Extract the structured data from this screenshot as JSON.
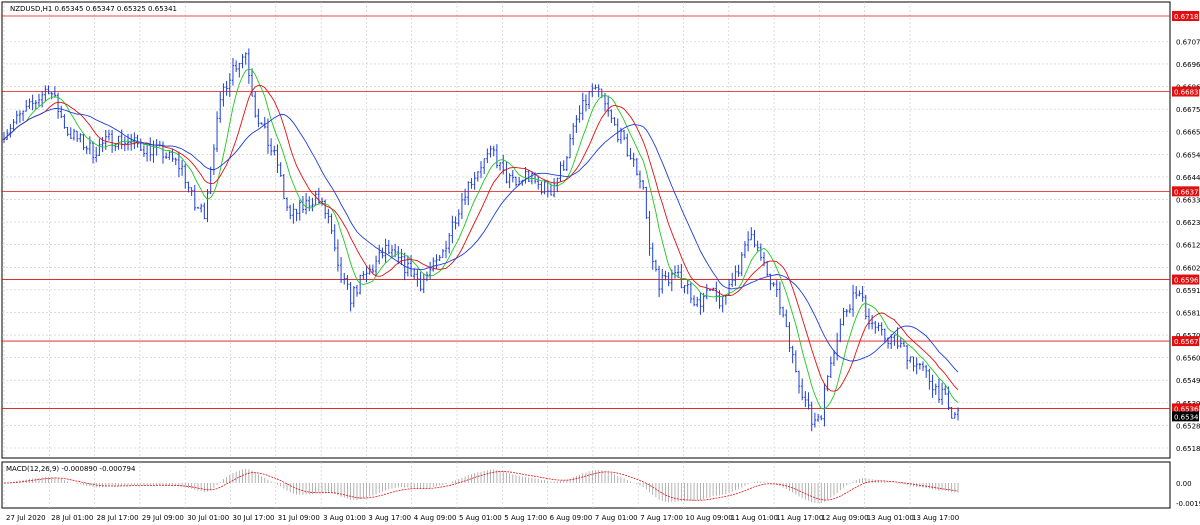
{
  "chart": {
    "symbol_header": "NZDUSD,H1  0.65345 0.65347 0.65325 0.65341"
  },
  "macd": {
    "header": "MACD(12,26,9) -0.000890 -0.000794",
    "ticks": [
      "0.00",
      "-0.00194"
    ]
  },
  "colors": {
    "background": "#ffffff",
    "grid": "#c8c8c8",
    "bars": "#1f3fd6",
    "level_lines": "#e01010",
    "ma_fast": "#1fc81f",
    "ma_mid": "#e01010",
    "ma_slow": "#1f3fd6",
    "macd_hist": "#a0a0a0",
    "macd_signal": "#e01010",
    "current_price_tag": "#000000"
  },
  "chart_data": {
    "type": "line",
    "series_kind": "ohlc-bars",
    "ylim": [
      0.6518,
      0.67188
    ],
    "y_ticks": [
      "0.67070",
      "0.66965",
      "0.66860",
      "0.66755",
      "0.66650",
      "0.66545",
      "0.66440",
      "0.66335",
      "0.66230",
      "0.66125",
      "0.66020",
      "0.65915",
      "0.65810",
      "0.65705",
      "0.65600",
      "0.65495",
      "0.65390",
      "0.65285",
      "0.65180"
    ],
    "x_ticks": [
      "27 Jul 2020",
      "28 Jul 01:00",
      "28 Jul 17:00",
      "29 Jul 09:00",
      "30 Jul 01:00",
      "30 Jul 17:00",
      "31 Jul 09:00",
      "3 Aug 01:00",
      "3 Aug 17:00",
      "4 Aug 09:00",
      "5 Aug 01:00",
      "5 Aug 17:00",
      "6 Aug 09:00",
      "7 Aug 01:00",
      "7 Aug 17:00",
      "10 Aug 09:00",
      "11 Aug 01:00",
      "11 Aug 17:00",
      "12 Aug 09:00",
      "13 Aug 01:00",
      "13 Aug 17:00"
    ],
    "levels": [
      {
        "label": "0.67188",
        "value": 0.67188
      },
      {
        "label": "0.66837",
        "value": 0.66837
      },
      {
        "label": "0.66373",
        "value": 0.66373
      },
      {
        "label": "0.65963",
        "value": 0.65963
      },
      {
        "label": "0.65677",
        "value": 0.65677
      },
      {
        "label": "0.65364",
        "value": 0.65364
      }
    ],
    "current_price": {
      "label": "0.65341",
      "value": 0.65341
    },
    "close_path": [
      [
        0,
        0.6665
      ],
      [
        8,
        0.6676
      ],
      [
        14,
        0.6686
      ],
      [
        20,
        0.6665
      ],
      [
        28,
        0.6656
      ],
      [
        34,
        0.6662
      ],
      [
        42,
        0.6659
      ],
      [
        50,
        0.6655
      ],
      [
        56,
        0.6648
      ],
      [
        60,
        0.663
      ],
      [
        63,
        0.6628
      ],
      [
        66,
        0.666
      ],
      [
        69,
        0.6685
      ],
      [
        72,
        0.6695
      ],
      [
        76,
        0.6702
      ],
      [
        79,
        0.6675
      ],
      [
        83,
        0.666
      ],
      [
        86,
        0.665
      ],
      [
        88,
        0.6635
      ],
      [
        90,
        0.6625
      ],
      [
        94,
        0.663
      ],
      [
        98,
        0.6635
      ],
      [
        102,
        0.6625
      ],
      [
        105,
        0.66
      ],
      [
        109,
        0.6588
      ],
      [
        112,
        0.6595
      ],
      [
        116,
        0.6602
      ],
      [
        120,
        0.661
      ],
      [
        124,
        0.6605
      ],
      [
        128,
        0.66
      ],
      [
        131,
        0.6595
      ],
      [
        134,
        0.66
      ],
      [
        137,
        0.6605
      ],
      [
        141,
        0.6622
      ],
      [
        145,
        0.6638
      ],
      [
        150,
        0.665
      ],
      [
        154,
        0.6655
      ],
      [
        157,
        0.6645
      ],
      [
        161,
        0.664
      ],
      [
        164,
        0.6645
      ],
      [
        168,
        0.664
      ],
      [
        172,
        0.6638
      ],
      [
        176,
        0.665
      ],
      [
        180,
        0.667
      ],
      [
        185,
        0.6685
      ],
      [
        188,
        0.668
      ],
      [
        191,
        0.667
      ],
      [
        194,
        0.6662
      ],
      [
        198,
        0.665
      ],
      [
        201,
        0.664
      ],
      [
        203,
        0.661
      ],
      [
        206,
        0.6595
      ],
      [
        210,
        0.6598
      ],
      [
        214,
        0.6595
      ],
      [
        218,
        0.6585
      ],
      [
        222,
        0.659
      ],
      [
        226,
        0.6585
      ],
      [
        229,
        0.6598
      ],
      [
        232,
        0.6605
      ],
      [
        235,
        0.662
      ],
      [
        238,
        0.6605
      ],
      [
        241,
        0.6595
      ],
      [
        244,
        0.6585
      ],
      [
        247,
        0.6565
      ],
      [
        251,
        0.6545
      ],
      [
        254,
        0.653
      ],
      [
        257,
        0.6535
      ],
      [
        260,
        0.656
      ],
      [
        264,
        0.658
      ],
      [
        268,
        0.6592
      ],
      [
        272,
        0.6578
      ],
      [
        276,
        0.657
      ],
      [
        280,
        0.6568
      ],
      [
        284,
        0.6562
      ],
      [
        288,
        0.6555
      ],
      [
        292,
        0.6548
      ],
      [
        296,
        0.654
      ],
      [
        298,
        0.6532
      ],
      [
        300,
        0.6534
      ]
    ],
    "indicators": [
      "MA fast",
      "MA mid",
      "MA slow",
      "MACD(12,26,9)"
    ]
  }
}
